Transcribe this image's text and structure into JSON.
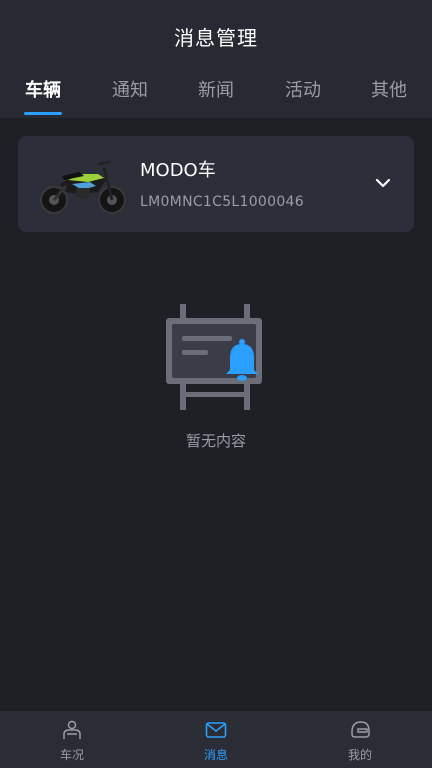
{
  "header": {
    "title": "消息管理"
  },
  "tabs": [
    {
      "label": "车辆",
      "active": true
    },
    {
      "label": "通知",
      "active": false
    },
    {
      "label": "新闻",
      "active": false
    },
    {
      "label": "活动",
      "active": false
    },
    {
      "label": "其他",
      "active": false
    }
  ],
  "vehicle": {
    "name": "MODO车",
    "vin": "LM0MNC1C5L1000046",
    "image": "electric-motorbike-image",
    "expand_icon": "chevron-down-icon"
  },
  "empty_state": {
    "icon": "message-board-bell-icon",
    "text": "暂无内容"
  },
  "bottom_nav": [
    {
      "label": "车况",
      "icon": "rider-icon",
      "active": false
    },
    {
      "label": "消息",
      "icon": "envelope-icon",
      "active": true
    },
    {
      "label": "我的",
      "icon": "helmet-icon",
      "active": false
    }
  ],
  "colors": {
    "background": "#1f1f26",
    "header_bg": "#272a33",
    "card_bg": "#2c2f39",
    "accent": "#2b9fff",
    "muted_text": "#9a9ca6"
  }
}
